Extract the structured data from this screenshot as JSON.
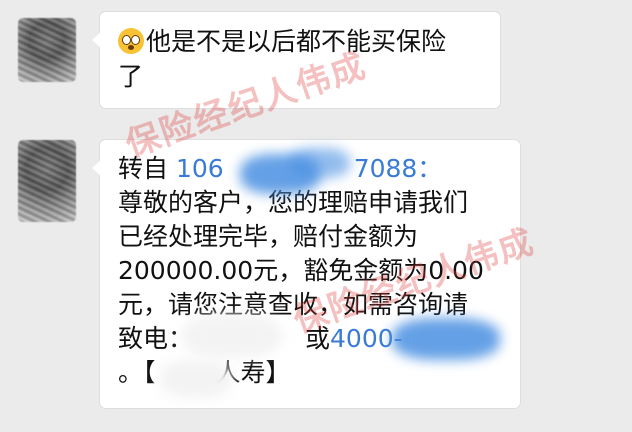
{
  "messages": [
    {
      "text_after_emoji": "他是不是以后都不能买保险\n了",
      "emoji": "astonished-face-icon"
    },
    {
      "line1_prefix": "转自",
      "line1_phone_start": "106",
      "line1_phone_end": "7088：",
      "body": "尊敬的客户，您的理赔申请我们\n已经处理完毕，赔付金额为\n200000.00元，豁免金额为0.00\n元，请您注意查收，如需咨询请",
      "line6_prefix": "致电：",
      "line6_mid": "或",
      "line6_phone": "4000-",
      "line7_start": "。【",
      "line7_end": "人寿】"
    }
  ],
  "watermarks": [
    "保险经纪人伟成",
    "保险经纪人伟成"
  ],
  "colors": {
    "background": "#ebebeb",
    "bubble": "#ffffff",
    "link": "#3a7bd5",
    "watermark": "#dc3c3c"
  }
}
